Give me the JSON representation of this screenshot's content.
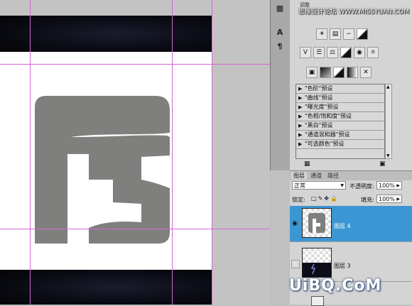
{
  "watermark_top": "思缘设计论坛 WWW.MISSYUAN.COM",
  "watermark_bottom": "UiBQ.CoM",
  "adjustments": {
    "panel_label": "调整",
    "presets": [
      "\"色阶\"预设",
      "\"曲线\"预设",
      "\"曝光度\"预设",
      "\"色相/饱和度\"预设",
      "\"黑白\"预设",
      "\"通道混和器\"预设",
      "\"可选颜色\"预设"
    ]
  },
  "layers": {
    "tabs": [
      "图层",
      "通道",
      "路径"
    ],
    "blend_mode": "正常",
    "opacity_label": "不透明度:",
    "opacity": "100%",
    "lock_label": "锁定:",
    "fill_label": "填充:",
    "fill": "100%",
    "items": [
      {
        "name": "图层 4",
        "selected": true,
        "visible": true
      },
      {
        "name": "图层 3",
        "selected": false,
        "visible": false
      }
    ]
  },
  "colors": {
    "selection_blue": "#3b97d3",
    "guide": "#d566d5",
    "logo_gray": "#7f7f7d"
  },
  "icons": {
    "strip": [
      "ps-icon",
      "type-icon",
      "paragraph-icon"
    ],
    "adjust_row1": [
      "brightness-icon",
      "levels-icon",
      "curves-icon",
      "exposure-icon"
    ],
    "adjust_row2": [
      "vibrance-icon",
      "hue-saturation-icon",
      "color-balance-icon",
      "black-white-icon",
      "photo-filter-icon",
      "channel-mixer-icon"
    ],
    "adjust_row3": [
      "invert-icon",
      "posterize-icon",
      "threshold-icon",
      "gradient-map-icon",
      "selective-color-icon"
    ]
  }
}
